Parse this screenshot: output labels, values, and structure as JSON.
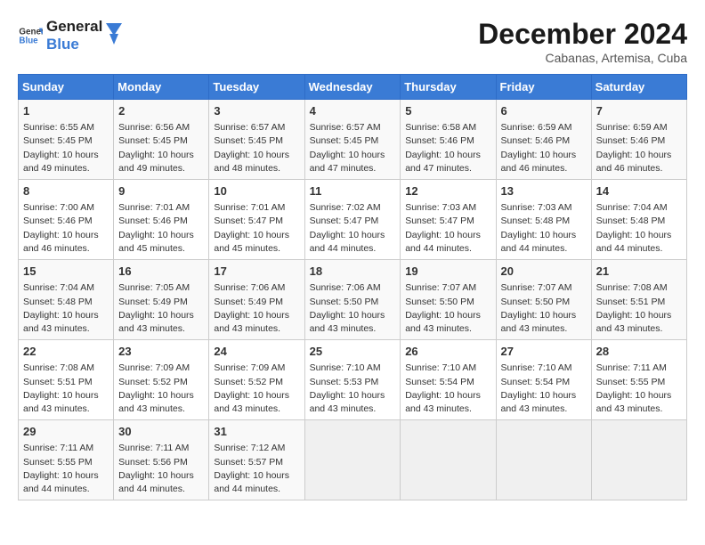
{
  "header": {
    "logo_line1": "General",
    "logo_line2": "Blue",
    "month": "December 2024",
    "location": "Cabanas, Artemisa, Cuba"
  },
  "weekdays": [
    "Sunday",
    "Monday",
    "Tuesday",
    "Wednesday",
    "Thursday",
    "Friday",
    "Saturday"
  ],
  "weeks": [
    [
      {
        "day": "1",
        "sunrise": "6:55 AM",
        "sunset": "5:45 PM",
        "daylight": "10 hours and 49 minutes."
      },
      {
        "day": "2",
        "sunrise": "6:56 AM",
        "sunset": "5:45 PM",
        "daylight": "10 hours and 49 minutes."
      },
      {
        "day": "3",
        "sunrise": "6:57 AM",
        "sunset": "5:45 PM",
        "daylight": "10 hours and 48 minutes."
      },
      {
        "day": "4",
        "sunrise": "6:57 AM",
        "sunset": "5:45 PM",
        "daylight": "10 hours and 47 minutes."
      },
      {
        "day": "5",
        "sunrise": "6:58 AM",
        "sunset": "5:46 PM",
        "daylight": "10 hours and 47 minutes."
      },
      {
        "day": "6",
        "sunrise": "6:59 AM",
        "sunset": "5:46 PM",
        "daylight": "10 hours and 46 minutes."
      },
      {
        "day": "7",
        "sunrise": "6:59 AM",
        "sunset": "5:46 PM",
        "daylight": "10 hours and 46 minutes."
      }
    ],
    [
      {
        "day": "8",
        "sunrise": "7:00 AM",
        "sunset": "5:46 PM",
        "daylight": "10 hours and 46 minutes."
      },
      {
        "day": "9",
        "sunrise": "7:01 AM",
        "sunset": "5:46 PM",
        "daylight": "10 hours and 45 minutes."
      },
      {
        "day": "10",
        "sunrise": "7:01 AM",
        "sunset": "5:47 PM",
        "daylight": "10 hours and 45 minutes."
      },
      {
        "day": "11",
        "sunrise": "7:02 AM",
        "sunset": "5:47 PM",
        "daylight": "10 hours and 44 minutes."
      },
      {
        "day": "12",
        "sunrise": "7:03 AM",
        "sunset": "5:47 PM",
        "daylight": "10 hours and 44 minutes."
      },
      {
        "day": "13",
        "sunrise": "7:03 AM",
        "sunset": "5:48 PM",
        "daylight": "10 hours and 44 minutes."
      },
      {
        "day": "14",
        "sunrise": "7:04 AM",
        "sunset": "5:48 PM",
        "daylight": "10 hours and 44 minutes."
      }
    ],
    [
      {
        "day": "15",
        "sunrise": "7:04 AM",
        "sunset": "5:48 PM",
        "daylight": "10 hours and 43 minutes."
      },
      {
        "day": "16",
        "sunrise": "7:05 AM",
        "sunset": "5:49 PM",
        "daylight": "10 hours and 43 minutes."
      },
      {
        "day": "17",
        "sunrise": "7:06 AM",
        "sunset": "5:49 PM",
        "daylight": "10 hours and 43 minutes."
      },
      {
        "day": "18",
        "sunrise": "7:06 AM",
        "sunset": "5:50 PM",
        "daylight": "10 hours and 43 minutes."
      },
      {
        "day": "19",
        "sunrise": "7:07 AM",
        "sunset": "5:50 PM",
        "daylight": "10 hours and 43 minutes."
      },
      {
        "day": "20",
        "sunrise": "7:07 AM",
        "sunset": "5:50 PM",
        "daylight": "10 hours and 43 minutes."
      },
      {
        "day": "21",
        "sunrise": "7:08 AM",
        "sunset": "5:51 PM",
        "daylight": "10 hours and 43 minutes."
      }
    ],
    [
      {
        "day": "22",
        "sunrise": "7:08 AM",
        "sunset": "5:51 PM",
        "daylight": "10 hours and 43 minutes."
      },
      {
        "day": "23",
        "sunrise": "7:09 AM",
        "sunset": "5:52 PM",
        "daylight": "10 hours and 43 minutes."
      },
      {
        "day": "24",
        "sunrise": "7:09 AM",
        "sunset": "5:52 PM",
        "daylight": "10 hours and 43 minutes."
      },
      {
        "day": "25",
        "sunrise": "7:10 AM",
        "sunset": "5:53 PM",
        "daylight": "10 hours and 43 minutes."
      },
      {
        "day": "26",
        "sunrise": "7:10 AM",
        "sunset": "5:54 PM",
        "daylight": "10 hours and 43 minutes."
      },
      {
        "day": "27",
        "sunrise": "7:10 AM",
        "sunset": "5:54 PM",
        "daylight": "10 hours and 43 minutes."
      },
      {
        "day": "28",
        "sunrise": "7:11 AM",
        "sunset": "5:55 PM",
        "daylight": "10 hours and 43 minutes."
      }
    ],
    [
      {
        "day": "29",
        "sunrise": "7:11 AM",
        "sunset": "5:55 PM",
        "daylight": "10 hours and 44 minutes."
      },
      {
        "day": "30",
        "sunrise": "7:11 AM",
        "sunset": "5:56 PM",
        "daylight": "10 hours and 44 minutes."
      },
      {
        "day": "31",
        "sunrise": "7:12 AM",
        "sunset": "5:57 PM",
        "daylight": "10 hours and 44 minutes."
      },
      null,
      null,
      null,
      null
    ]
  ]
}
